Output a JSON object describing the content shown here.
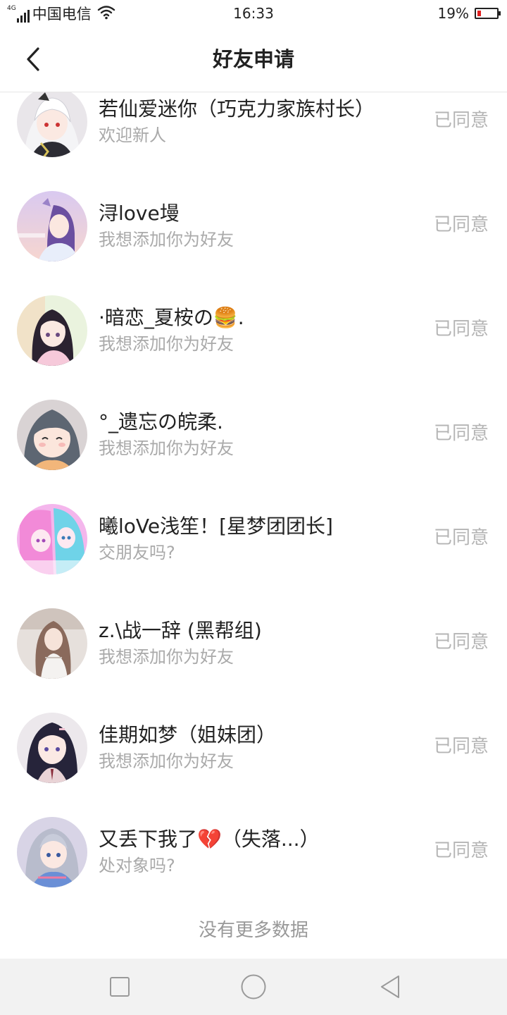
{
  "status_bar": {
    "network": "4G",
    "carrier": "中国电信",
    "time": "16:33",
    "battery_percent": "19%",
    "battery_level": 0.19
  },
  "header": {
    "title": "好友申请",
    "back_icon": "chevron-left-icon"
  },
  "requests": [
    {
      "name": "若仙爱迷你（巧克力家族村长）",
      "message": "欢迎新人",
      "status": "已同意"
    },
    {
      "name": "浔love墁",
      "message": "我想添加你为好友",
      "status": "已同意"
    },
    {
      "name": "·暗恋_夏桉の🍔.",
      "message": "我想添加你为好友",
      "status": "已同意"
    },
    {
      "name": "°_遗忘の皖柔.",
      "message": "我想添加你为好友",
      "status": "已同意"
    },
    {
      "name": "曦loVe浅笙！[星梦团团长]",
      "message": "交朋友吗?",
      "status": "已同意"
    },
    {
      "name": "z.\\战一辞 (黑帮组)",
      "message": "我想添加你为好友",
      "status": "已同意"
    },
    {
      "name": "佳期如梦（姐妹团）",
      "message": "我想添加你为好友",
      "status": "已同意"
    },
    {
      "name": "又丢下我了💔（失落...）",
      "message": "处对象吗?",
      "status": "已同意"
    }
  ],
  "footer": {
    "no_more": "没有更多数据"
  },
  "system_nav": {
    "recents_icon": "square-icon",
    "home_icon": "circle-icon",
    "back_icon": "triangle-back-icon"
  },
  "colors": {
    "status_text": "#b5b5b5",
    "message_text": "#aaaaaa",
    "battery_low": "#e02020"
  }
}
